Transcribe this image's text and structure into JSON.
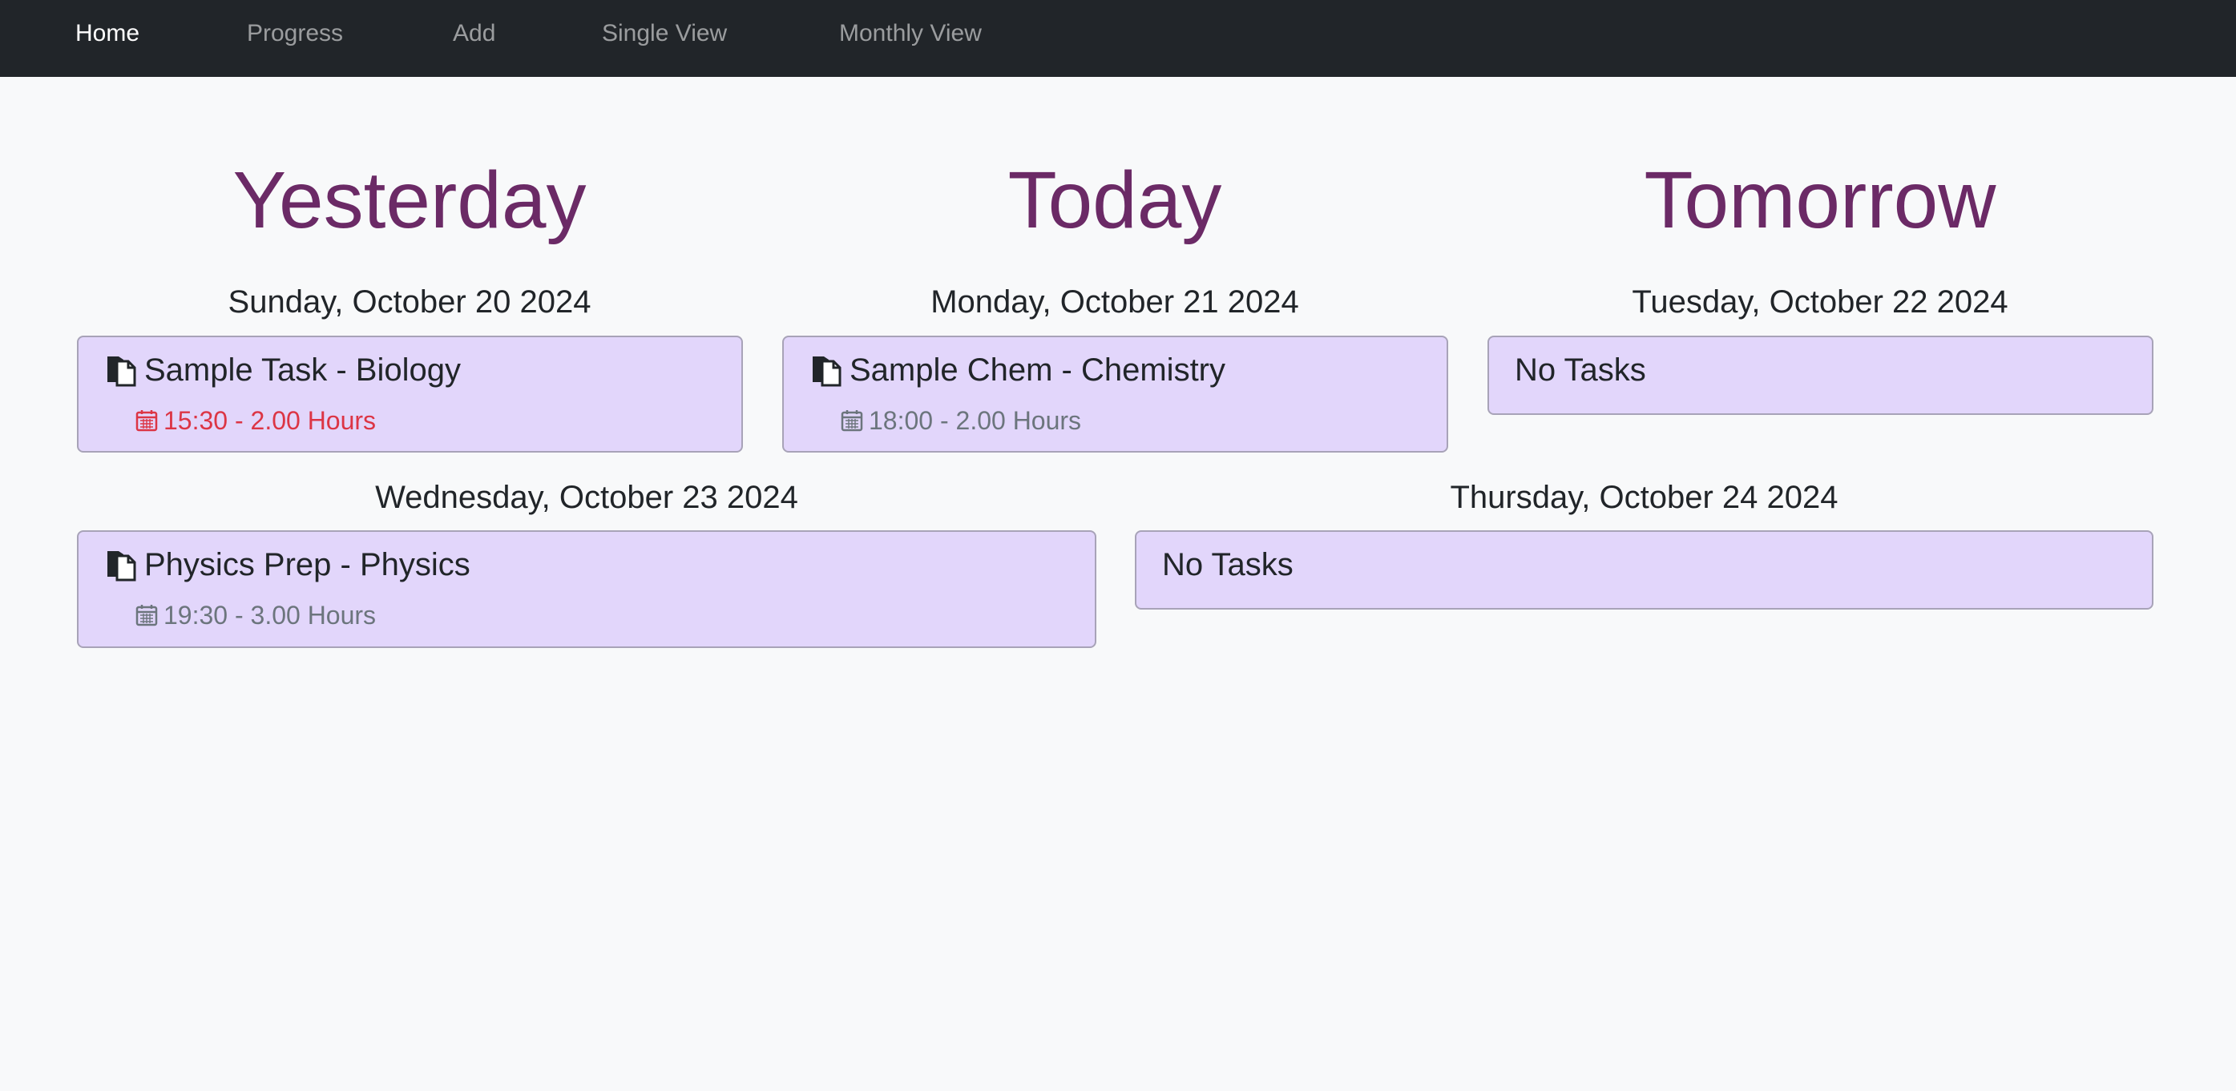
{
  "nav": {
    "items": [
      {
        "label": "Home",
        "active": true
      },
      {
        "label": "Progress",
        "active": false
      },
      {
        "label": "Add",
        "active": false
      },
      {
        "label": "Single View",
        "active": false
      },
      {
        "label": "Monthly View",
        "active": false
      }
    ]
  },
  "headings": {
    "yesterday": "Yesterday",
    "today": "Today",
    "tomorrow": "Tomorrow"
  },
  "days": [
    {
      "date": "Sunday, October 20 2024",
      "task": {
        "title": "Sample Task - Biology",
        "meta": "15:30 - 2.00 Hours",
        "icon": "book-icon",
        "meta_icon": "calendar-icon",
        "overdue": true
      }
    },
    {
      "date": "Monday, October 21 2024",
      "task": {
        "title": "Sample Chem - Chemistry",
        "meta": "18:00 - 2.00 Hours",
        "icon": "book-icon",
        "meta_icon": "calendar-icon",
        "overdue": false
      }
    },
    {
      "date": "Tuesday, October 22 2024",
      "empty_text": "No Tasks"
    },
    {
      "date": "Wednesday, October 23 2024",
      "task": {
        "title": "Physics Prep - Physics",
        "meta": "19:30 - 3.00 Hours",
        "icon": "book-icon",
        "meta_icon": "calendar-icon",
        "overdue": false
      }
    },
    {
      "date": "Thursday, October 24 2024",
      "empty_text": "No Tasks"
    }
  ],
  "colors": {
    "navbar_bg": "#212529",
    "heading": "#6b2a66",
    "card_bg": "#e2d6fb",
    "overdue": "#dc3545",
    "muted": "#6c757d"
  }
}
